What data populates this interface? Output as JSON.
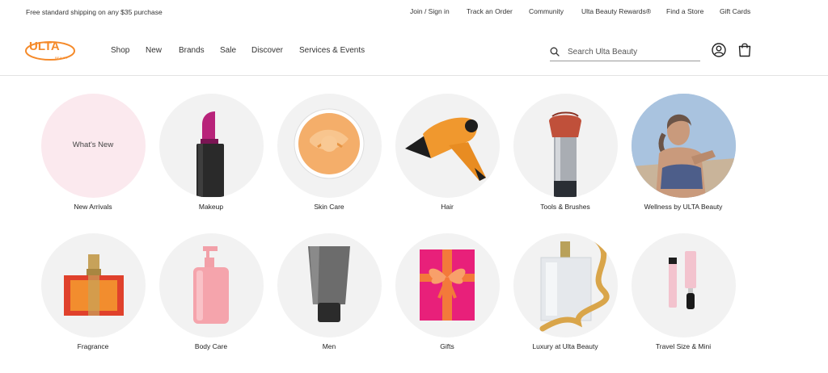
{
  "topbar": {
    "promo": "Free standard shipping on any $35 purchase",
    "links": [
      "Join / Sign in",
      "Track an Order",
      "Community",
      "Ulta Beauty Rewards®",
      "Find a Store",
      "Gift Cards"
    ]
  },
  "header": {
    "logo_text": "ULTA",
    "logo_subtext": "BEAUTY",
    "nav": [
      "Shop",
      "New",
      "Brands",
      "Sale",
      "Discover",
      "Services & Events"
    ],
    "search_placeholder": "Search Ulta Beauty",
    "search_value": ""
  },
  "categories": {
    "row1": [
      {
        "label": "New Arrivals",
        "inner": "What's New",
        "icon": "whats-new"
      },
      {
        "label": "Makeup",
        "icon": "lipstick"
      },
      {
        "label": "Skin Care",
        "icon": "cream-jar"
      },
      {
        "label": "Hair",
        "icon": "hair-dryer"
      },
      {
        "label": "Tools & Brushes",
        "icon": "makeup-brush"
      },
      {
        "label": "Wellness by ULTA Beauty",
        "icon": "wellness-photo"
      }
    ],
    "row2": [
      {
        "label": "Fragrance",
        "icon": "perfume-bottle"
      },
      {
        "label": "Body Care",
        "icon": "lotion-pump"
      },
      {
        "label": "Men",
        "icon": "tube"
      },
      {
        "label": "Gifts",
        "icon": "gift-box"
      },
      {
        "label": "Luxury at Ulta Beauty",
        "icon": "luxury-perfume"
      },
      {
        "label": "Travel Size & Mini",
        "icon": "mini-mascara"
      }
    ]
  },
  "colors": {
    "brand_orange": "#f58a2a",
    "circle_bg": "#f2f2f2",
    "new_circle_bg": "#fbe9ee"
  }
}
